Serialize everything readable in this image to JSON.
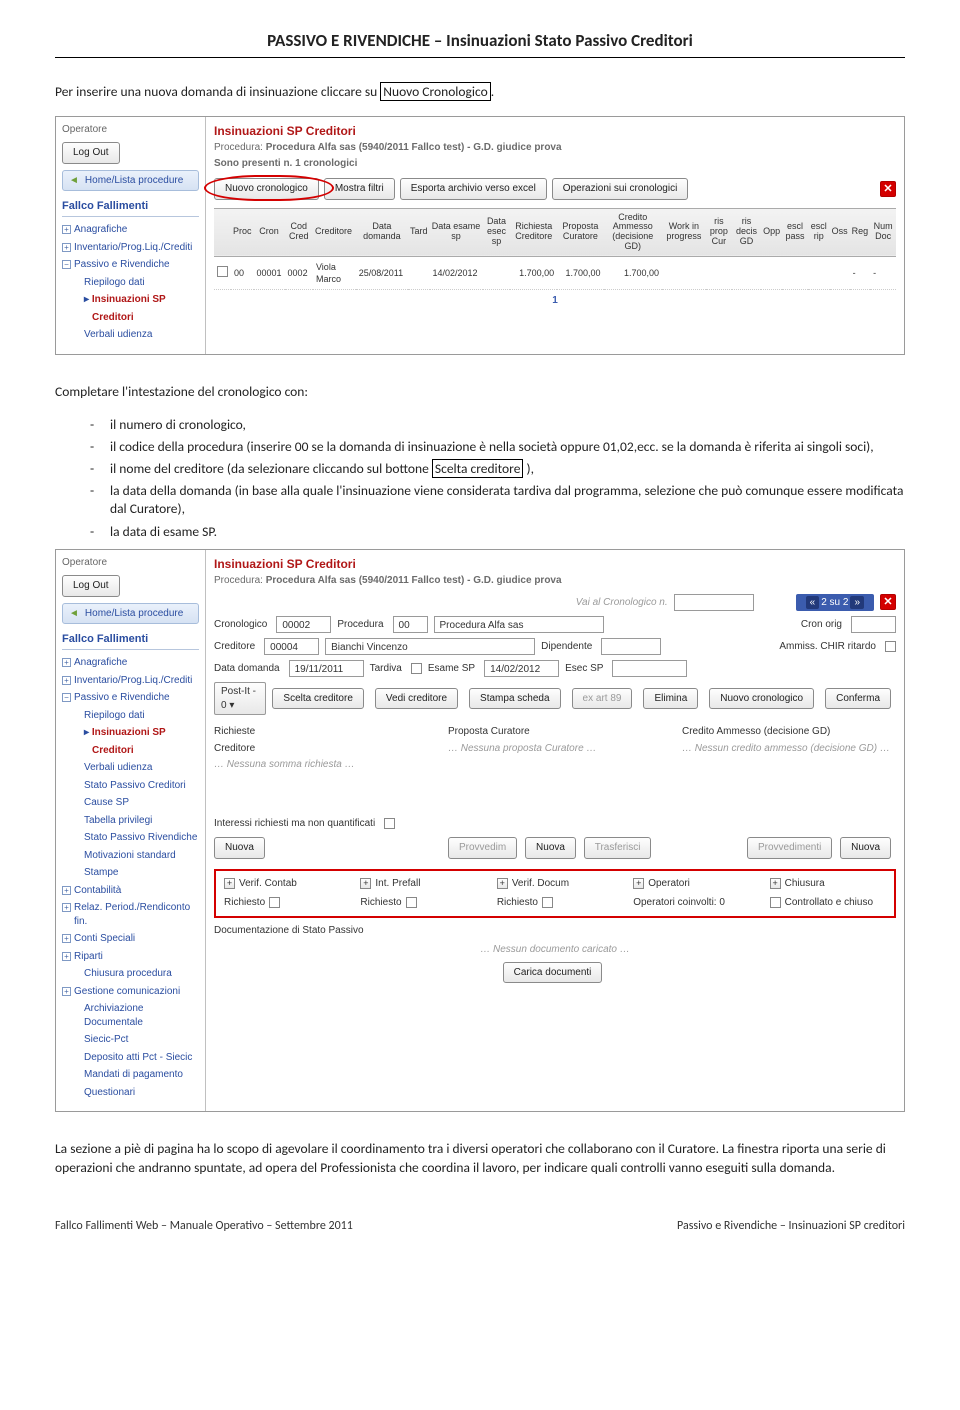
{
  "page": {
    "title": "PASSIVO E RIVENDICHE – Insinuazioni Stato Passivo Creditori",
    "intro_pre": "Per inserire una nuova domanda di insinuazione cliccare su ",
    "intro_boxed": "Nuovo Cronologico",
    "intro_post": ".",
    "outro": "La sezione a piè di pagina ha lo scopo di agevolare il coordinamento tra i diversi operatori che collaborano con il Curatore. La finestra riporta una serie di operazioni che andranno spuntate, ad opera del Professionista che coordina il lavoro, per indicare quali controlli vanno eseguiti sulla domanda.",
    "completare": "Completare l'intestazione del cronologico con:",
    "bullets": {
      "b1": "il numero di cronologico,",
      "b2": "il codice della procedura (inserire 00 se la domanda di insinuazione è nella società oppure 01,02,ecc. se la domanda è riferita ai singoli soci),",
      "b3_pre": "il nome del creditore (da selezionare cliccando sul bottone ",
      "b3_box": "Scelta creditore",
      "b3_post": " ),",
      "b4": "la data della domanda (in base alla quale l'insinuazione viene considerata tardiva dal programma, selezione che può comunque essere modificata dal Curatore),",
      "b5": "la data di esame SP."
    },
    "footer_left": "Fallco Fallimenti Web – Manuale Operativo – Settembre 2011",
    "footer_right": "Passivo e Rivendiche – Insinuazioni SP creditori"
  },
  "common": {
    "operatore": "Operatore",
    "logout": "Log Out",
    "home": "Home/Lista procedure",
    "brand": "Fallco Fallimenti",
    "side": {
      "anagrafiche": "Anagrafiche",
      "inventario": "Inventario/Prog.Liq./Crediti",
      "passivo": "Passivo e Rivendiche",
      "riepilogo": "Riepilogo dati",
      "insinuazioni1": "Insinuazioni SP",
      "insinuazioni2": "Creditori",
      "verbali": "Verbali udienza",
      "statopc": "Stato Passivo Creditori",
      "cause": "Cause SP",
      "tabpriv": "Tabella privilegi",
      "statopr": "Stato Passivo Rivendiche",
      "motiv": "Motivazioni standard",
      "stampe": "Stampe",
      "contab": "Contabilità",
      "relaz": "Relaz. Period./Rendiconto fin.",
      "conti": "Conti Speciali",
      "riparti": "Riparti",
      "chiusura": "Chiusura procedura",
      "gestcom": "Gestione comunicazioni",
      "archdoc": "Archiviazione Documentale",
      "siecic": "Siecic-Pct",
      "deposito": "Deposito atti Pct - Siecic",
      "mandati": "Mandati di pagamento",
      "quest": "Questionari"
    }
  },
  "shot1": {
    "title": "Insinuazioni SP Creditori",
    "proc_label": "Procedura:",
    "proc_value": "Procedura Alfa sas (5940/2011 Fallco test) - G.D. giudice prova",
    "presenti": "Sono presenti n. 1 cronologici",
    "btns": {
      "nuovo": "Nuovo cronologico",
      "mostra": "Mostra filtri",
      "esporta": "Esporta archivio verso excel",
      "operaz": "Operazioni sui cronologici"
    },
    "cols": {
      "proc": "Proc",
      "cron": "Cron",
      "codcred": "Cod Cred",
      "creditore": "Creditore",
      "datadom": "Data domanda",
      "tard": "Tard",
      "dataesamesp": "Data esame sp",
      "dataesecsp": "Data esec sp",
      "richiesta": "Richiesta Creditore",
      "proposta": "Proposta Curatore",
      "credito": "Credito Ammesso (decisione GD)",
      "wip": "Work in progress",
      "risprop": "ris prop Cur",
      "risdecis": "ris decis GD",
      "opp": "Opp",
      "esclpass": "escl pass",
      "esclrip": "escl rip",
      "oss": "Oss",
      "reg": "Reg",
      "numdoc": "Num Doc"
    },
    "row": {
      "proc": "00",
      "cron": "00001",
      "codcred": "0002",
      "creditore": "Viola Marco",
      "datadom": "25/08/2011",
      "dataesamesp": "14/02/2012",
      "rich": "1.700,00",
      "prop": "1.700,00",
      "cred": "1.700,00",
      "dash": "-"
    },
    "pager": "1"
  },
  "shot2": {
    "title": "Insinuazioni SP Creditori",
    "proc_label": "Procedura:",
    "proc_value": "Procedura Alfa sas (5940/2011 Fallco test) - G.D. giudice prova",
    "vai": "Vai al Cronologico n.",
    "nav": "2 su 2",
    "labels": {
      "cronologico": "Cronologico",
      "procedura": "Procedura",
      "proc_nome": "Procedura Alfa sas",
      "cronorig": "Cron orig",
      "creditore": "Creditore",
      "cred_nome": "Bianchi Vincenzo",
      "dipendente": "Dipendente",
      "ammiss": "Ammiss. CHIR ritardo",
      "datadom": "Data domanda",
      "tardiva": "Tardiva",
      "esamesp": "Esame SP",
      "esecsp": "Esec SP",
      "postit": "Post-It - 0",
      "scelta": "Scelta creditore",
      "vedi": "Vedi creditore",
      "stampa": "Stampa scheda",
      "exart": "ex art 89",
      "elimina": "Elimina",
      "nuovo": "Nuovo cronologico",
      "conferma": "Conferma"
    },
    "vals": {
      "cronologico": "00002",
      "procedura": "00",
      "creditore": "00004",
      "datadom": "19/11/2011",
      "esamesp": "14/02/2012"
    },
    "threecol": {
      "rich_h1": "Richieste",
      "rich_h2": "Creditore",
      "rich_it": "… Nessuna somma richiesta …",
      "prop_h": "Proposta Curatore",
      "prop_it": "… Nessuna proposta Curatore …",
      "cred_h": "Credito Ammesso (decisione GD)",
      "cred_it": "… Nessun credito ammesso (decisione GD) …",
      "interessi": "Interessi richiesti ma non quantificati",
      "nuova": "Nuova",
      "provvedim": "Provvedim",
      "trasferisci": "Trasferisci",
      "provvedimenti": "Provvedimenti"
    },
    "red": {
      "verifcontab": "Verif. Contab",
      "intprefall": "Int. Prefall",
      "verifdocum": "Verif. Docum",
      "operatori": "Operatori",
      "chiusura": "Chiusura",
      "richiesto": "Richiesto",
      "opcoinv": "Operatori coinvolti: 0",
      "controllato": "Controllato e chiuso",
      "docstato": "Documentazione di Stato Passivo",
      "nessun": "… Nessun documento caricato …",
      "carica": "Carica documenti"
    }
  }
}
